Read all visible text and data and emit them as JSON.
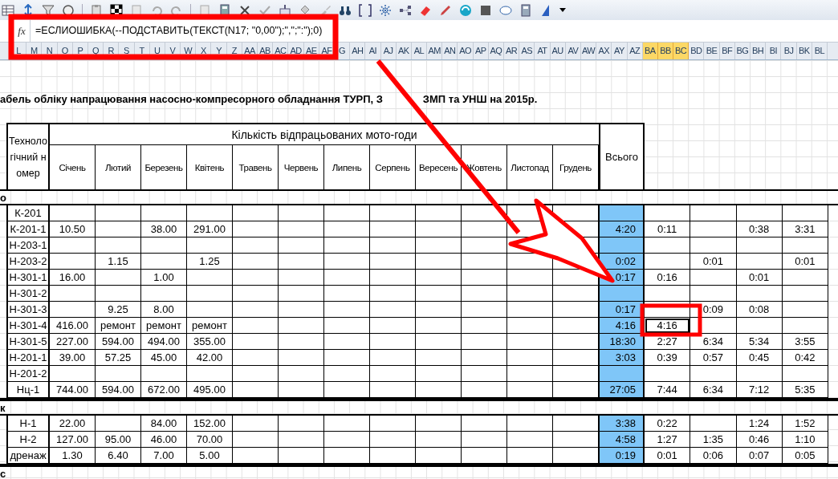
{
  "formula_bar": {
    "function_label": "fx",
    "formula": "=ЕСЛИОШИБКА(--ПОДСТАВИТЬ(ТЕКСТ(N17; \"0,00\");\",\";\":\");0)"
  },
  "column_headers": [
    {
      "label": "L",
      "selected": false
    },
    {
      "label": "M",
      "selected": false
    },
    {
      "label": "N",
      "selected": false
    },
    {
      "label": "O",
      "selected": false
    },
    {
      "label": "P",
      "selected": false
    },
    {
      "label": "Q",
      "selected": false
    },
    {
      "label": "R",
      "selected": false
    },
    {
      "label": "S",
      "selected": false
    },
    {
      "label": "T",
      "selected": false
    },
    {
      "label": "U",
      "selected": false
    },
    {
      "label": "V",
      "selected": false
    },
    {
      "label": "W",
      "selected": false
    },
    {
      "label": "X",
      "selected": false
    },
    {
      "label": "Y",
      "selected": false
    },
    {
      "label": "Z",
      "selected": false
    },
    {
      "label": "AA",
      "selected": false
    },
    {
      "label": "AB",
      "selected": false
    },
    {
      "label": "AC",
      "selected": false
    },
    {
      "label": "AD",
      "selected": false
    },
    {
      "label": "AE",
      "selected": false
    },
    {
      "label": "AF",
      "selected": false
    },
    {
      "label": "G",
      "selected": false
    },
    {
      "label": "AH",
      "selected": false
    },
    {
      "label": "AI",
      "selected": false
    },
    {
      "label": "AJ",
      "selected": false
    },
    {
      "label": "AK",
      "selected": false
    },
    {
      "label": "AL",
      "selected": false
    },
    {
      "label": "AM",
      "selected": false
    },
    {
      "label": "AN",
      "selected": false
    },
    {
      "label": "AO",
      "selected": false
    },
    {
      "label": "AP",
      "selected": false
    },
    {
      "label": "AQ",
      "selected": false
    },
    {
      "label": "AR",
      "selected": false
    },
    {
      "label": "AS",
      "selected": false
    },
    {
      "label": "AT",
      "selected": false
    },
    {
      "label": "AU",
      "selected": false
    },
    {
      "label": "AV",
      "selected": false
    },
    {
      "label": "AW",
      "selected": false
    },
    {
      "label": "AX",
      "selected": false
    },
    {
      "label": "AY",
      "selected": false
    },
    {
      "label": "AZ",
      "selected": false
    },
    {
      "label": "BA",
      "selected": true
    },
    {
      "label": "BB",
      "selected": true
    },
    {
      "label": "BC",
      "selected": true
    },
    {
      "label": "BD",
      "selected": false
    },
    {
      "label": "BE",
      "selected": false
    },
    {
      "label": "BF",
      "selected": false
    },
    {
      "label": "BG",
      "selected": false
    },
    {
      "label": "BH",
      "selected": false
    },
    {
      "label": "BI",
      "selected": false
    },
    {
      "label": "BJ",
      "selected": false
    },
    {
      "label": "BK",
      "selected": false
    },
    {
      "label": "BL",
      "selected": false
    }
  ],
  "title": [
    "абель обліку напрацювання насосно-компресорного обладнання ТУРП, З",
    "ЗМП та УНШ на 2015р."
  ],
  "table": {
    "id_header": "Технологічний номер",
    "group_header": "Кількість відпрацьованих мото-годи",
    "months": [
      "Січень",
      "Лютий",
      "Березень",
      "Квітень",
      "Травень",
      "Червень",
      "Липень",
      "Серпень",
      "Вересень",
      "Жовтень",
      "Листопад",
      "Грудень"
    ],
    "total_header": "Всього",
    "groups": [
      {
        "label": "о",
        "rows": [
          {
            "id": "К-201",
            "extra": [
              {
                "selected": false
              },
              {
                "selected": false
              },
              {
                "selected": false
              },
              {
                "selected": false
              }
            ]
          },
          {
            "id": "К-201-1",
            "values": {
              "jan": "10.50",
              "mar": "38.00",
              "apr": "291.00"
            },
            "total": "4:20",
            "extra": [
              {
                "value": "0:11",
                "selected": false
              },
              {
                "selected": false
              },
              {
                "value": "0:38",
                "selected": false
              },
              {
                "value": "3:31",
                "selected": false
              }
            ]
          },
          {
            "id": "Н-203-1",
            "extra": [
              {
                "selected": false
              },
              {
                "selected": false
              },
              {
                "selected": false
              },
              {
                "selected": false
              }
            ]
          },
          {
            "id": "Н-203-2",
            "values": {
              "feb": "1.15",
              "apr": "1.25"
            },
            "total": "0:02",
            "extra": [
              {
                "selected": false
              },
              {
                "value": "0:01",
                "selected": false
              },
              {
                "selected": false
              },
              {
                "value": "0:01",
                "selected": false
              }
            ]
          },
          {
            "id": "Н-301-1",
            "values": {
              "jan": "16.00",
              "mar": "1.00"
            },
            "total": "0:17",
            "extra": [
              {
                "value": "0:16",
                "selected": false
              },
              {
                "selected": false
              },
              {
                "value": "0:01",
                "selected": false
              },
              {
                "selected": false
              }
            ]
          },
          {
            "id": "Н-301-2",
            "extra": [
              {
                "selected": false
              },
              {
                "selected": false
              },
              {
                "selected": false
              },
              {
                "selected": false
              }
            ]
          },
          {
            "id": "Н-301-3",
            "values": {
              "feb": "9.25",
              "mar": "8.00"
            },
            "total": "0:17",
            "extra": [
              {
                "selected": false
              },
              {
                "value": "0:09",
                "selected": false
              },
              {
                "value": "0:08",
                "selected": false
              },
              {
                "selected": false
              }
            ]
          },
          {
            "id": "Н-301-4",
            "values": {
              "jan": "416.00",
              "feb": "ремонт",
              "mar": "ремонт",
              "apr": "ремонт"
            },
            "total": "4:16",
            "extra": [
              {
                "value": "4:16",
                "selected": true
              },
              {
                "selected": false
              },
              {
                "selected": false
              },
              {
                "selected": false
              }
            ]
          },
          {
            "id": "Н-301-5",
            "values": {
              "jan": "227.00",
              "feb": "594.00",
              "mar": "494.00",
              "apr": "355.00"
            },
            "total": "18:30",
            "extra": [
              {
                "value": "2:27",
                "selected": false
              },
              {
                "value": "6:34",
                "selected": false
              },
              {
                "value": "5:34",
                "selected": false
              },
              {
                "value": "3:55",
                "selected": false
              }
            ]
          },
          {
            "id": "Н-201-1",
            "values": {
              "jan": "39.00",
              "feb": "57.25",
              "mar": "45.00",
              "apr": "42.00"
            },
            "total": "3:03",
            "extra": [
              {
                "value": "0:39",
                "selected": false
              },
              {
                "value": "0:57",
                "selected": false
              },
              {
                "value": "0:45",
                "selected": false
              },
              {
                "value": "0:42",
                "selected": false
              }
            ]
          },
          {
            "id": "Н-201-2",
            "extra": [
              {
                "selected": false
              },
              {
                "selected": false
              },
              {
                "selected": false
              },
              {
                "selected": false
              }
            ]
          },
          {
            "id": "Нц-1",
            "values": {
              "jan": "744.00",
              "feb": "594.00",
              "mar": "672.00",
              "apr": "495.00"
            },
            "total": "27:05",
            "extra": [
              {
                "value": "7:44",
                "selected": false
              },
              {
                "value": "6:34",
                "selected": false
              },
              {
                "value": "7:12",
                "selected": false
              },
              {
                "value": "5:35",
                "selected": false
              }
            ]
          }
        ]
      },
      {
        "label": "к",
        "rows": [
          {
            "id": "Н-1",
            "values": {
              "jan": "22.00",
              "mar": "84.00",
              "apr": "152.00"
            },
            "total": "3:38",
            "extra": [
              {
                "value": "0:22",
                "selected": false
              },
              {
                "selected": false
              },
              {
                "value": "1:24",
                "selected": false
              },
              {
                "value": "1:52",
                "selected": false
              }
            ]
          },
          {
            "id": "Н-2",
            "values": {
              "jan": "127.00",
              "feb": "95.00",
              "mar": "46.00",
              "apr": "70.00"
            },
            "total": "4:58",
            "extra": [
              {
                "value": "1:27",
                "selected": false
              },
              {
                "value": "1:35",
                "selected": false
              },
              {
                "value": "0:46",
                "selected": false
              },
              {
                "value": "1:10",
                "selected": false
              }
            ]
          },
          {
            "id": "дренаж",
            "values": {
              "jan": "1.30",
              "feb": "6.40",
              "mar": "7.00",
              "apr": "5.00"
            },
            "total": "0:19",
            "extra": [
              {
                "value": "0:01",
                "selected": false
              },
              {
                "value": "0:06",
                "selected": false
              },
              {
                "value": "0:07",
                "selected": false
              },
              {
                "value": "0:05",
                "selected": false
              }
            ]
          }
        ]
      }
    ],
    "footer_label": "с"
  }
}
